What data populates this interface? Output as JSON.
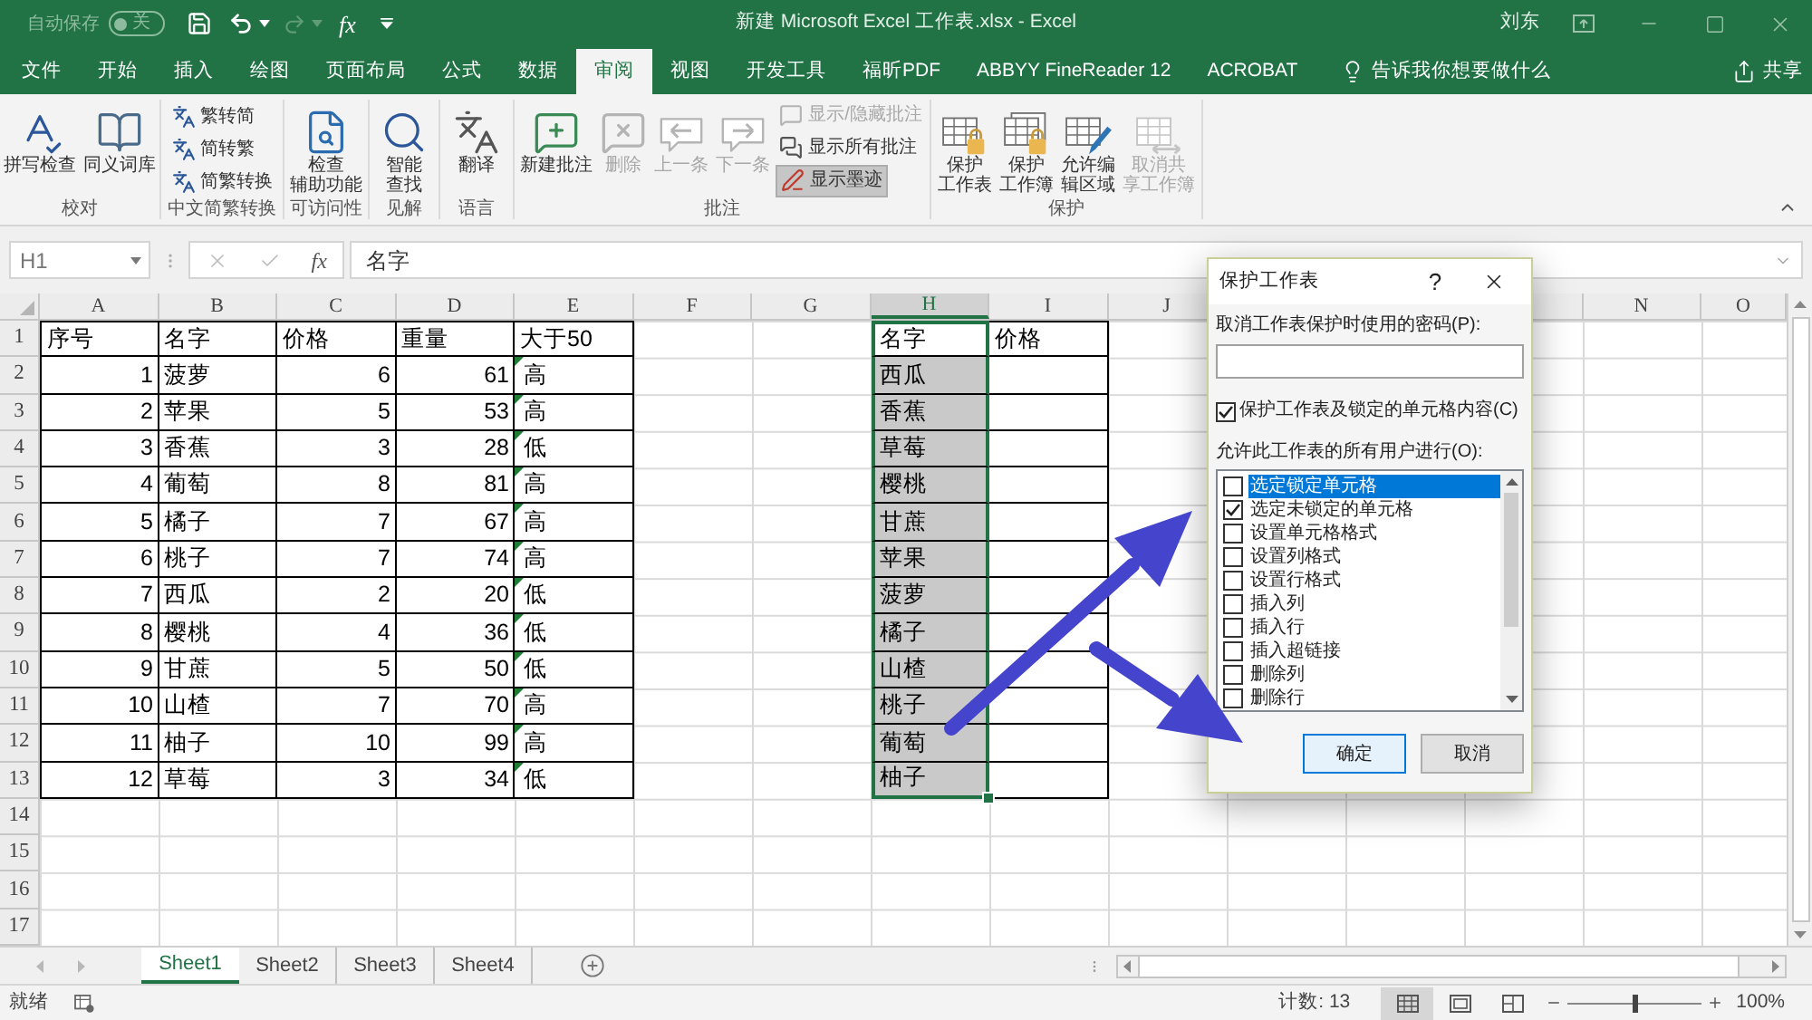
{
  "title_bar": {
    "autosave": {
      "label": "自动保存",
      "state_text": "关",
      "on": false
    },
    "quick_access": [
      {
        "disabled": false
      },
      {
        "disabled": false
      },
      {
        "disabled": true
      }
    ],
    "function_symbol": "fx",
    "title": "新建 Microsoft Excel 工作表.xlsx - Excel",
    "user": "刘东"
  },
  "ribbon_tabs": [
    {
      "label": "文件",
      "selected": false
    },
    {
      "label": "开始",
      "selected": false
    },
    {
      "label": "插入",
      "selected": false
    },
    {
      "label": "绘图",
      "selected": false
    },
    {
      "label": "页面布局",
      "selected": false
    },
    {
      "label": "公式",
      "selected": false
    },
    {
      "label": "数据",
      "selected": false
    },
    {
      "label": "审阅",
      "selected": true
    },
    {
      "label": "视图",
      "selected": false
    },
    {
      "label": "开发工具",
      "selected": false
    },
    {
      "label": "福昕PDF",
      "selected": false
    },
    {
      "label": "ABBYY FineReader 12",
      "selected": false
    },
    {
      "label": "ACROBAT",
      "selected": false
    }
  ],
  "tell_me": "告诉我你想要做什么",
  "share": "共享",
  "ribbon_groups": [
    {
      "label": "校对",
      "commands": [
        {
          "kind": "large",
          "label_lines": [
            "拼写检查"
          ],
          "disabled": false
        },
        {
          "kind": "large",
          "label_lines": [
            "同义词库"
          ],
          "disabled": false
        }
      ]
    },
    {
      "label": "中文简繁转换",
      "commands": [
        {
          "kind": "small",
          "label_lines": [
            "繁转简"
          ],
          "disabled": false
        },
        {
          "kind": "small",
          "label_lines": [
            "简转繁"
          ],
          "disabled": false
        },
        {
          "kind": "small",
          "label_lines": [
            "简繁转换"
          ],
          "disabled": false
        }
      ]
    },
    {
      "label": "可访问性",
      "commands": [
        {
          "kind": "large",
          "label_lines": [
            "检查",
            "辅助功能"
          ],
          "disabled": false
        }
      ]
    },
    {
      "label": "见解",
      "commands": [
        {
          "kind": "large",
          "label_lines": [
            "智能",
            "查找"
          ],
          "disabled": false
        }
      ]
    },
    {
      "label": "语言",
      "commands": [
        {
          "kind": "large",
          "label_lines": [
            "翻译"
          ],
          "disabled": false
        }
      ]
    },
    {
      "label": "批注",
      "commands": [
        {
          "kind": "large",
          "label_lines": [
            "新建批注"
          ],
          "disabled": false,
          "pressed": false
        },
        {
          "kind": "large",
          "label_lines": [
            "删除"
          ],
          "disabled": true,
          "pressed": false
        },
        {
          "kind": "large",
          "label_lines": [
            "上一条"
          ],
          "disabled": true,
          "pressed": false
        },
        {
          "kind": "large",
          "label_lines": [
            "下一条"
          ],
          "disabled": true,
          "pressed": false
        },
        {
          "kind": "small",
          "label_lines": [
            "显示/隐藏批注"
          ],
          "disabled": true,
          "pressed": false
        },
        {
          "kind": "small",
          "label_lines": [
            "显示所有批注"
          ],
          "disabled": false,
          "pressed": false
        },
        {
          "kind": "small",
          "label_lines": [
            "显示墨迹"
          ],
          "disabled": false,
          "pressed": true
        }
      ]
    },
    {
      "label": "保护",
      "commands": [
        {
          "kind": "large",
          "label_lines": [
            "保护",
            "工作表"
          ],
          "disabled": false
        },
        {
          "kind": "large",
          "label_lines": [
            "保护",
            "工作簿"
          ],
          "disabled": false
        },
        {
          "kind": "large",
          "label_lines": [
            "允许编",
            "辑区域"
          ],
          "disabled": false
        },
        {
          "kind": "large",
          "label_lines": [
            "取消共",
            "享工作簿"
          ],
          "disabled": true
        }
      ]
    }
  ],
  "formula_bar": {
    "name_box": "H1",
    "function_symbol": "fx",
    "content": "名字"
  },
  "sheet": {
    "columns": [
      {
        "label": "A",
        "selected": false
      },
      {
        "label": "B",
        "selected": false
      },
      {
        "label": "C",
        "selected": false
      },
      {
        "label": "D",
        "selected": false
      },
      {
        "label": "E",
        "selected": false
      },
      {
        "label": "F",
        "selected": false
      },
      {
        "label": "G",
        "selected": false
      },
      {
        "label": "H",
        "selected": true
      },
      {
        "label": "I",
        "selected": false
      },
      {
        "label": "J",
        "selected": false
      },
      null,
      null,
      null,
      {
        "label": "N",
        "selected": false
      },
      {
        "label": "O",
        "selected": false
      }
    ],
    "row_headers": [
      "1",
      "2",
      "3",
      "4",
      "5",
      "6",
      "7",
      "8",
      "9",
      "10",
      "11",
      "12",
      "13",
      "14",
      "15",
      "16",
      "17"
    ],
    "table_1": {
      "header": [
        "序号",
        "名字",
        "价格",
        "重量",
        "大于50"
      ],
      "rows": [
        {
          "cells": [
            "1",
            "菠萝",
            "6",
            "61",
            "高"
          ],
          "flagged": true
        },
        {
          "cells": [
            "2",
            "苹果",
            "5",
            "53",
            "高"
          ],
          "flagged": true
        },
        {
          "cells": [
            "3",
            "香蕉",
            "3",
            "28",
            "低"
          ],
          "flagged": true
        },
        {
          "cells": [
            "4",
            "葡萄",
            "8",
            "81",
            "高"
          ],
          "flagged": true
        },
        {
          "cells": [
            "5",
            "橘子",
            "7",
            "67",
            "高"
          ],
          "flagged": true
        },
        {
          "cells": [
            "6",
            "桃子",
            "7",
            "74",
            "高"
          ],
          "flagged": true
        },
        {
          "cells": [
            "7",
            "西瓜",
            "2",
            "20",
            "低"
          ],
          "flagged": true
        },
        {
          "cells": [
            "8",
            "樱桃",
            "4",
            "36",
            "低"
          ],
          "flagged": true
        },
        {
          "cells": [
            "9",
            "甘蔗",
            "5",
            "50",
            "低"
          ],
          "flagged": true
        },
        {
          "cells": [
            "10",
            "山楂",
            "7",
            "70",
            "高"
          ],
          "flagged": true
        },
        {
          "cells": [
            "11",
            "柚子",
            "10",
            "99",
            "高"
          ],
          "flagged": true
        },
        {
          "cells": [
            "12",
            "草莓",
            "3",
            "34",
            "低"
          ],
          "flagged": true
        }
      ]
    },
    "table_2": {
      "header": [
        "名字",
        "价格"
      ],
      "rows": [
        "西瓜",
        "香蕉",
        "草莓",
        "樱桃",
        "甘蔗",
        "苹果",
        "菠萝",
        "橘子",
        "山楂",
        "桃子",
        "葡萄",
        "柚子"
      ]
    }
  },
  "dialog": {
    "title": "保护工作表",
    "help": "?",
    "password_label": "取消工作表保护时使用的密码(P):",
    "protect_option": {
      "label": "保护工作表及锁定的单元格内容(C)",
      "checked": true
    },
    "permissions_label": "允许此工作表的所有用户进行(O):",
    "permissions": [
      {
        "label": "选定锁定单元格",
        "checked": false,
        "selected": true
      },
      {
        "label": "选定未锁定的单元格",
        "checked": true,
        "selected": false
      },
      {
        "label": "设置单元格格式",
        "checked": false,
        "selected": false
      },
      {
        "label": "设置列格式",
        "checked": false,
        "selected": false
      },
      {
        "label": "设置行格式",
        "checked": false,
        "selected": false
      },
      {
        "label": "插入列",
        "checked": false,
        "selected": false
      },
      {
        "label": "插入行",
        "checked": false,
        "selected": false
      },
      {
        "label": "插入超链接",
        "checked": false,
        "selected": false
      },
      {
        "label": "删除列",
        "checked": false,
        "selected": false
      },
      {
        "label": "删除行",
        "checked": false,
        "selected": false
      }
    ],
    "buttons": [
      {
        "label": "确定",
        "default": true
      },
      {
        "label": "取消",
        "default": false
      }
    ]
  },
  "sheet_tabs": [
    {
      "label": "Sheet1",
      "selected": true
    },
    {
      "label": "Sheet2",
      "selected": false
    },
    {
      "label": "Sheet3",
      "selected": false
    },
    {
      "label": "Sheet4",
      "selected": false
    }
  ],
  "status_bar": {
    "mode": "就绪",
    "count": "计数: 13",
    "views": [
      {
        "selected": true
      },
      {
        "selected": false
      },
      {
        "selected": false
      }
    ],
    "zoom": {
      "level": 0.5,
      "reading": "100%"
    }
  }
}
